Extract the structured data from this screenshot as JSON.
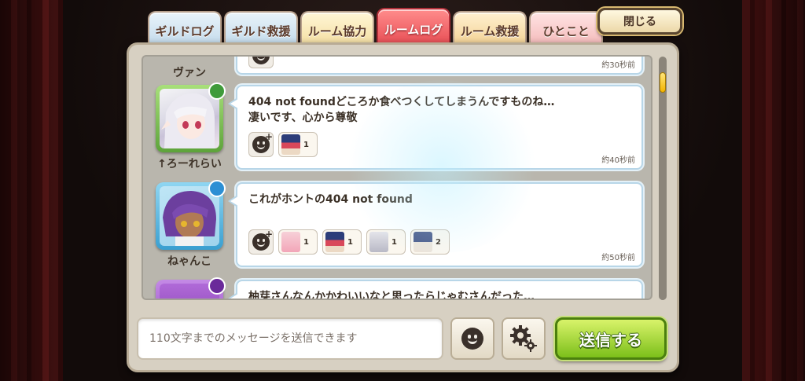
{
  "tabs": [
    {
      "label": "ギルドログ"
    },
    {
      "label": "ギルド救援"
    },
    {
      "label": "ルーム協力"
    },
    {
      "label": "ルームログ"
    },
    {
      "label": "ルーム救援"
    },
    {
      "label": "ひとこと"
    }
  ],
  "active_tab": "ルームログ",
  "close_label": "閉じる",
  "messages": [
    {
      "name": "ヴァン",
      "time": "約30秒前",
      "lines": []
    },
    {
      "name": "↑ろーれらい",
      "time": "約40秒前",
      "lines": [
        "404 not foundどころか食べつくしてしまうんですものね…",
        "凄いです、心から尊敬"
      ],
      "stamps": [
        {
          "count": "1"
        }
      ]
    },
    {
      "name": "ねゃんこ",
      "time": "約50秒前",
      "lines": [
        "これがホントの404 not found"
      ],
      "stamps": [
        {
          "count": "1"
        },
        {
          "count": "1"
        },
        {
          "count": "1"
        },
        {
          "count": "2"
        }
      ]
    },
    {
      "name": "",
      "time": "",
      "lines": [
        "柚芽さんなんかかわいいなと思ったらじゃむさんだった…"
      ]
    }
  ],
  "input": {
    "placeholder": "110文字までのメッセージを送信できます"
  },
  "send_label": "送信する",
  "colors": {
    "active_tab": "#e5474e",
    "send_button": "#7cbf1a",
    "bubble_border": "#b8d6e8"
  }
}
